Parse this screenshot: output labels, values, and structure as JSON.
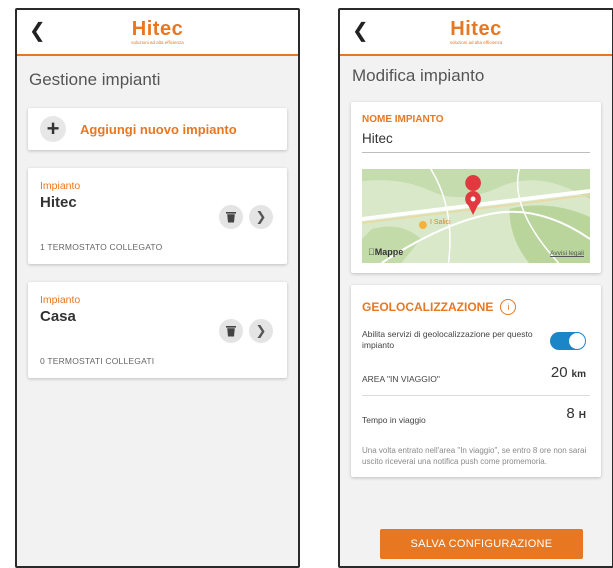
{
  "left_screen": {
    "back_icon": "chevron-left",
    "logo": {
      "text": "Hitec",
      "tagline": "soluzioni ad alta efficienza"
    },
    "title": "Gestione impianti",
    "add_button_label": "Aggiungi nuovo impianto",
    "plants": [
      {
        "kicker": "Impianto",
        "name": "Hitec",
        "status": "1 TERMOSTATO COLLEGATO"
      },
      {
        "kicker": "Impianto",
        "name": "Casa",
        "status": "0 TERMOSTATI COLLEGATI"
      }
    ]
  },
  "right_screen": {
    "back_icon": "chevron-left",
    "logo": {
      "text": "Hitec",
      "tagline": "soluzioni ad alta efficienza"
    },
    "title": "Modifica impianto",
    "name_field": {
      "label": "NOME IMPIANTO",
      "value": "Hitec"
    },
    "map": {
      "place_label": "I Salici",
      "credit": "Mappe",
      "legal": "Avvisi legali"
    },
    "geo": {
      "title": "GEOLOCALIZZAZIONE",
      "info_icon": "info-circle",
      "toggle_label": "Abilita servizi di geolocalizzazione per questo impianto",
      "toggle_on": true,
      "area_label": "AREA \"IN VIAGGIO\"",
      "area_value": "20",
      "area_unit": "km",
      "time_label": "Tempo in viaggio",
      "time_value": "8",
      "time_unit": "H",
      "help": "Una volta entrato nell'area \"In viaggio\", se entro 8 ore non sarai uscito riceverai una notifica push come promemoria."
    },
    "save_button_label": "SALVA CONFIGURAZIONE"
  },
  "colors": {
    "accent": "#e87722",
    "toggle": "#1a86c8",
    "background": "#f2f2f2"
  }
}
